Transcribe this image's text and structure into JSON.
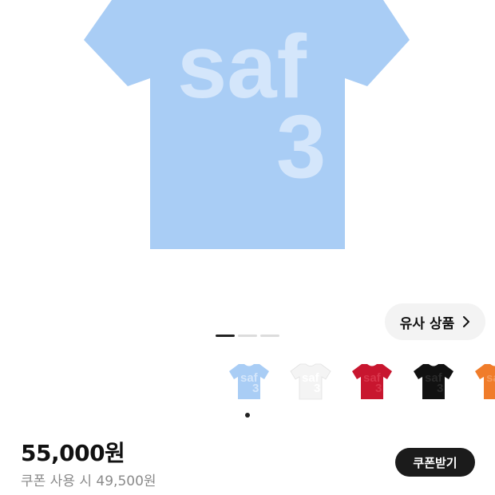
{
  "product": {
    "image_graphic": {
      "text_line1": "saf",
      "text_line2": "3",
      "shirt_color": "#a9cdf5",
      "print_color": "#d4e6fb"
    },
    "similar_button_label": "유사 상품",
    "carousel": {
      "total": 3,
      "active_index": 0
    },
    "color_options": [
      {
        "color": "#a9cdf5",
        "print": "#d4e6fb"
      },
      {
        "color": "#f4f4f4",
        "print": "#ffffff"
      },
      {
        "color": "#c8162f",
        "print": "#d9354b"
      },
      {
        "color": "#111111",
        "print": "#2a2a2a"
      },
      {
        "color": "#f07c2a",
        "print": "#f59b5b"
      }
    ],
    "selected_color_index": 0,
    "price": "55,000원",
    "coupon_price_text": "쿠폰 사용 시 49,500원",
    "coupon_button_label": "쿠폰받기"
  }
}
